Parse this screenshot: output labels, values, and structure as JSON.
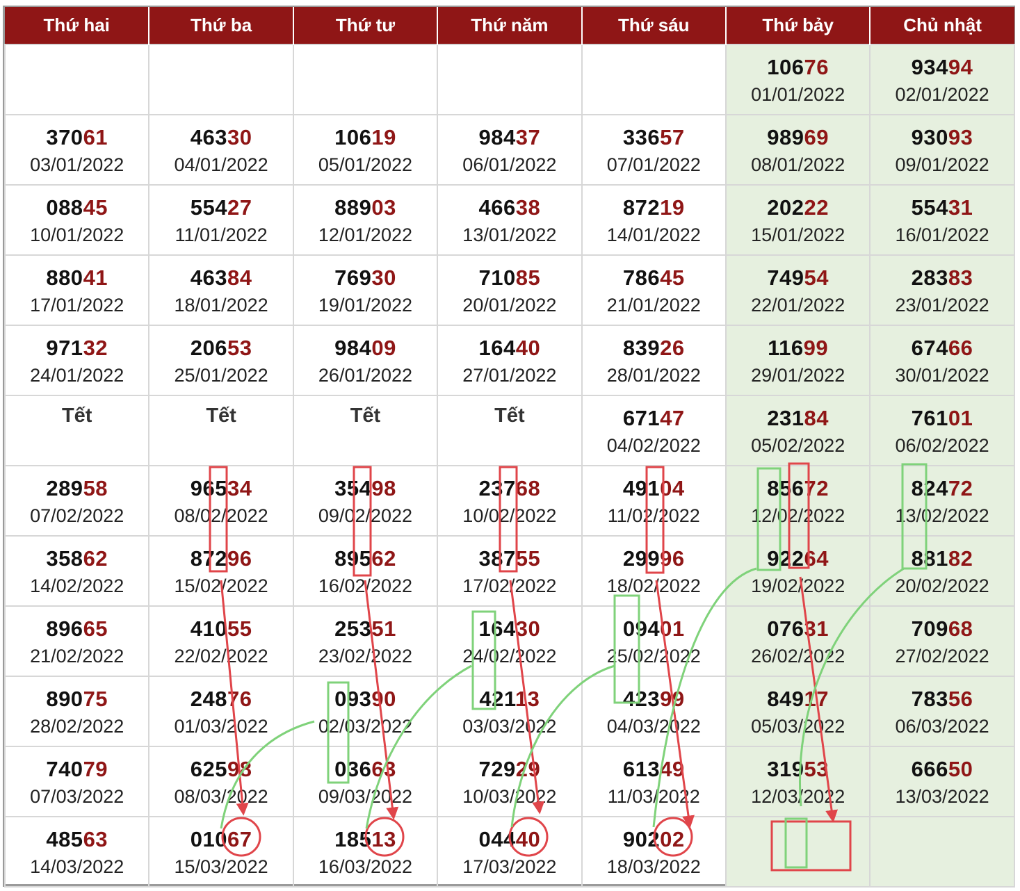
{
  "header": {
    "days": [
      "Thứ hai",
      "Thứ ba",
      "Thứ tư",
      "Thứ năm",
      "Thứ sáu",
      "Thứ bảy",
      "Chủ nhật"
    ]
  },
  "rows": [
    [
      null,
      null,
      null,
      null,
      null,
      {
        "num": "10676",
        "date": "01/01/2022"
      },
      {
        "num": "93494",
        "date": "02/01/2022"
      }
    ],
    [
      {
        "num": "37061",
        "date": "03/01/2022"
      },
      {
        "num": "46330",
        "date": "04/01/2022"
      },
      {
        "num": "10619",
        "date": "05/01/2022"
      },
      {
        "num": "98437",
        "date": "06/01/2022"
      },
      {
        "num": "33657",
        "date": "07/01/2022"
      },
      {
        "num": "98969",
        "date": "08/01/2022"
      },
      {
        "num": "93093",
        "date": "09/01/2022"
      }
    ],
    [
      {
        "num": "08845",
        "date": "10/01/2022"
      },
      {
        "num": "55427",
        "date": "11/01/2022"
      },
      {
        "num": "88903",
        "date": "12/01/2022"
      },
      {
        "num": "46638",
        "date": "13/01/2022"
      },
      {
        "num": "87219",
        "date": "14/01/2022"
      },
      {
        "num": "20222",
        "date": "15/01/2022"
      },
      {
        "num": "55431",
        "date": "16/01/2022"
      }
    ],
    [
      {
        "num": "88041",
        "date": "17/01/2022"
      },
      {
        "num": "46384",
        "date": "18/01/2022"
      },
      {
        "num": "76930",
        "date": "19/01/2022"
      },
      {
        "num": "71085",
        "date": "20/01/2022"
      },
      {
        "num": "78645",
        "date": "21/01/2022"
      },
      {
        "num": "74954",
        "date": "22/01/2022"
      },
      {
        "num": "28383",
        "date": "23/01/2022"
      }
    ],
    [
      {
        "num": "97132",
        "date": "24/01/2022"
      },
      {
        "num": "20653",
        "date": "25/01/2022"
      },
      {
        "num": "98409",
        "date": "26/01/2022"
      },
      {
        "num": "16440",
        "date": "27/01/2022"
      },
      {
        "num": "83926",
        "date": "28/01/2022"
      },
      {
        "num": "11699",
        "date": "29/01/2022"
      },
      {
        "num": "67466",
        "date": "30/01/2022"
      }
    ],
    [
      {
        "tet": "Tết"
      },
      {
        "tet": "Tết"
      },
      {
        "tet": "Tết"
      },
      {
        "tet": "Tết"
      },
      {
        "num": "67147",
        "date": "04/02/2022"
      },
      {
        "num": "23184",
        "date": "05/02/2022"
      },
      {
        "num": "76101",
        "date": "06/02/2022"
      }
    ],
    [
      {
        "num": "28958",
        "date": "07/02/2022"
      },
      {
        "num": "96534",
        "date": "08/02/2022"
      },
      {
        "num": "35498",
        "date": "09/02/2022"
      },
      {
        "num": "23768",
        "date": "10/02/2022"
      },
      {
        "num": "49104",
        "date": "11/02/2022"
      },
      {
        "num": "85672",
        "date": "12/02/2022"
      },
      {
        "num": "82472",
        "date": "13/02/2022"
      }
    ],
    [
      {
        "num": "35862",
        "date": "14/02/2022"
      },
      {
        "num": "87296",
        "date": "15/02/2022"
      },
      {
        "num": "89562",
        "date": "16/02/2022"
      },
      {
        "num": "38755",
        "date": "17/02/2022"
      },
      {
        "num": "29996",
        "date": "18/02/2022"
      },
      {
        "num": "92264",
        "date": "19/02/2022"
      },
      {
        "num": "88182",
        "date": "20/02/2022"
      }
    ],
    [
      {
        "num": "89665",
        "date": "21/02/2022"
      },
      {
        "num": "41055",
        "date": "22/02/2022"
      },
      {
        "num": "25351",
        "date": "23/02/2022"
      },
      {
        "num": "16430",
        "date": "24/02/2022"
      },
      {
        "num": "09401",
        "date": "25/02/2022"
      },
      {
        "num": "07631",
        "date": "26/02/2022"
      },
      {
        "num": "70968",
        "date": "27/02/2022"
      }
    ],
    [
      {
        "num": "89075",
        "date": "28/02/2022"
      },
      {
        "num": "24876",
        "date": "01/03/2022"
      },
      {
        "num": "09390",
        "date": "02/03/2022"
      },
      {
        "num": "42113",
        "date": "03/03/2022"
      },
      {
        "num": "42399",
        "date": "04/03/2022"
      },
      {
        "num": "84917",
        "date": "05/03/2022"
      },
      {
        "num": "78356",
        "date": "06/03/2022"
      }
    ],
    [
      {
        "num": "74079",
        "date": "07/03/2022"
      },
      {
        "num": "62598",
        "date": "08/03/2022"
      },
      {
        "num": "03663",
        "date": "09/03/2022"
      },
      {
        "num": "72929",
        "date": "10/03/2022"
      },
      {
        "num": "61349",
        "date": "11/03/2022"
      },
      {
        "num": "31953",
        "date": "12/03/2022"
      },
      {
        "num": "66650",
        "date": "13/03/2022"
      }
    ],
    [
      {
        "num": "48563",
        "date": "14/03/2022"
      },
      {
        "num": "01067",
        "date": "15/03/2022"
      },
      {
        "num": "18513",
        "date": "16/03/2022"
      },
      {
        "num": "04440",
        "date": "17/03/2022"
      },
      {
        "num": "90202",
        "date": "18/03/2022"
      },
      null,
      null
    ]
  ],
  "colors": {
    "header_bg": "#8f1616",
    "tail_digits": "#8f1616",
    "weekend_bg": "#e6f0df",
    "red_marker": "#e0454a",
    "green_marker": "#7fd27a"
  }
}
